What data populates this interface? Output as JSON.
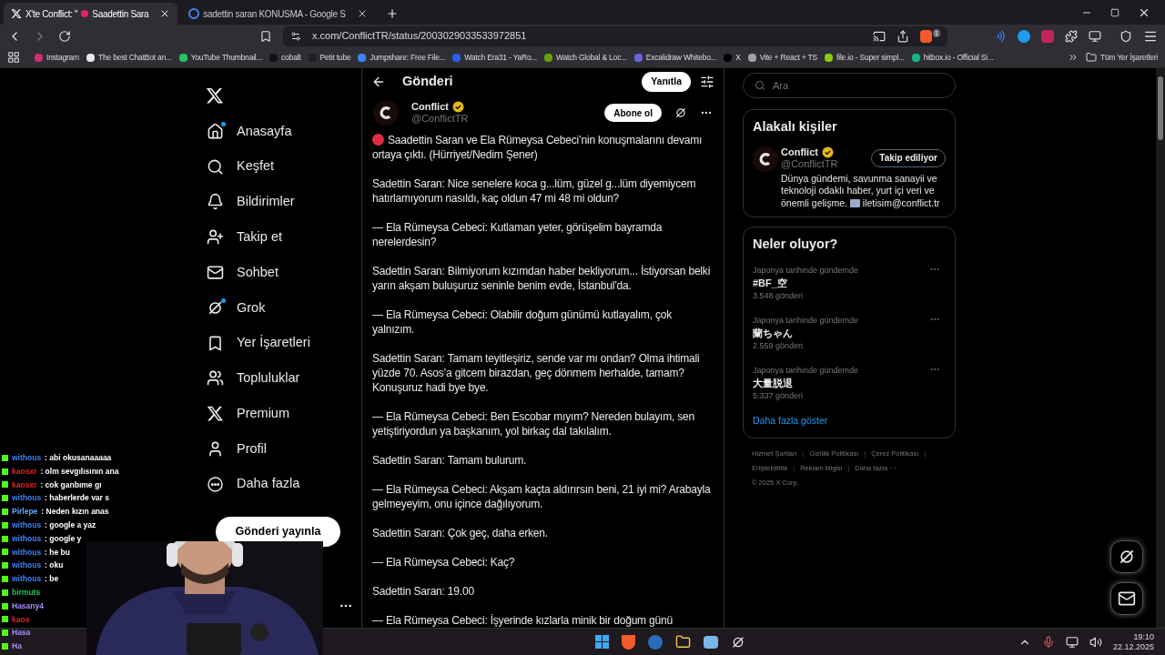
{
  "browser": {
    "tabs": [
      {
        "title": "X'te Conflict: \"",
        "title_rest": "Saadettin Sara",
        "selected": true,
        "kind": "x"
      },
      {
        "title": "sadettin saran KONUSMA - Google S",
        "selected": false,
        "kind": "google"
      }
    ],
    "url": "x.com/ConflictTR/status/2003029033533972851",
    "shield_count": "1",
    "bookmarks": [
      {
        "label": "Instagram",
        "color": "#d62976"
      },
      {
        "label": "The best ChatBot an...",
        "color": "#e5e7eb"
      },
      {
        "label": "YouTube Thumbnail...",
        "color": "#22c55e"
      },
      {
        "label": "cobalt",
        "color": "#111111"
      },
      {
        "label": "Petit tube",
        "color": "#1f1f1f"
      },
      {
        "label": "Jumpshare: Free File...",
        "color": "#3b82f6"
      },
      {
        "label": "Watch Era31 - YaRo...",
        "color": "#2563eb"
      },
      {
        "label": "Watch Global & Loc...",
        "color": "#65a30d"
      },
      {
        "label": "Excalidraw Whitebo...",
        "color": "#6965db"
      },
      {
        "label": "X",
        "color": "#000000"
      },
      {
        "label": "Vite + React + TS",
        "color": "#9ca3af"
      },
      {
        "label": "file.io - Super simpl...",
        "color": "#84cc16"
      },
      {
        "label": "hitbox.io - Official Si...",
        "color": "#10b981"
      }
    ],
    "all_bookmarks": "Tüm Yer İşaretleri"
  },
  "nav": {
    "items": [
      {
        "label": "Anasayfa",
        "kind": "home",
        "dot": true
      },
      {
        "label": "Keşfet",
        "kind": "search",
        "dot": false
      },
      {
        "label": "Bildirimler",
        "kind": "bell",
        "dot": false
      },
      {
        "label": "Takip et",
        "kind": "follow",
        "dot": false
      },
      {
        "label": "Sohbet",
        "kind": "mail",
        "dot": false
      },
      {
        "label": "Grok",
        "kind": "grok",
        "dot": true
      },
      {
        "label": "Yer İşaretleri",
        "kind": "bookmark",
        "dot": false
      },
      {
        "label": "Topluluklar",
        "kind": "people",
        "dot": false
      },
      {
        "label": "Premium",
        "kind": "x",
        "dot": false
      },
      {
        "label": "Profil",
        "kind": "user",
        "dot": false
      },
      {
        "label": "Daha fazla",
        "kind": "more",
        "dot": false
      }
    ],
    "post_button": "Gönderi yayınla"
  },
  "post": {
    "header": "Gönderi",
    "reply_button": "Yanıtla",
    "author": {
      "name": "Conflict",
      "handle": "@ConflictTR",
      "verified": true
    },
    "follow_button": "Abone ol",
    "paragraphs": [
      "Saadettin Saran ve Ela Rümeysa Cebeci’nin konuşmalarını devamı ortaya çıktı. (Hürriyet/Nedim Şener)",
      "Sadettin Saran: Nice senelere koca g...lüm, güzel g...lüm diyemiycem hatırlamıyorum nasıldı, kaç oldun 47 mi 48 mi oldun?",
      "— Ela Rümeysa Cebeci: Kutlaman yeter, görüşelim bayramda nerelerdesin?",
      "Sadettin Saran: Bilmiyorum kızımdan haber bekliyorum... İstiyorsan belki yarın akşam buluşuruz seninle benim evde, İstanbul’da.",
      "— Ela Rümeysa Cebeci: Olabilir doğum günümü kutlayalım, çok yalnızım.",
      "Sadettin Saran: Tamam teyitleşiriz, sende var mı ondan? Olma ihtimali yüzde 70. Asos’a gitcem birazdan, geç dönmem herhalde, tamam? Konuşuruz hadi bye bye.",
      "— Ela Rümeysa Cebeci: Ben Escobar mıyım? Nereden bulayım, sen yetiştiriyordun ya başkanım, yol birkaç dal takılalım.",
      "Sadettin Saran: Tamam bulurum.",
      "— Ela Rümeysa Cebeci: Akşam kaçta aldırırsın beni, 21 iyi mi? Arabayla gelmeyeyim, onu içince dağılıyorum.",
      "Sadettin Saran: Çok geç, daha erken.",
      "— Ela Rümeysa Cebeci: Kaç?",
      "Sadettin Saran: 19.00",
      "— Ela Rümeysa Cebeci: İşyerinde kızlarla minik bir doğum günü"
    ]
  },
  "sidebar": {
    "search_placeholder": "Ara",
    "related": {
      "title": "Alakalı kişiler",
      "name": "Conflict",
      "handle": "@ConflictTR",
      "verified": true,
      "button": "Takip ediliyor",
      "bio": "Dünya gündemi, savunma sanayii ve teknoloji odaklı haber, yurt içi veri ve önemli gelişme.",
      "bio_link": "iletisim@conflict.tr"
    },
    "trends": {
      "title": "Neler oluyor?",
      "items": [
        {
          "context": "Japonya tarihinde gündemde",
          "name": "#BF_空",
          "count": "3.548 gönderi"
        },
        {
          "context": "Japonya tarihinde gündemde",
          "name": "蘭ちゃん",
          "count": "2.559 gönderi"
        },
        {
          "context": "Japonya tarihinde gündemde",
          "name": "大量脱退",
          "count": "5.337 gönderi"
        }
      ],
      "more": "Daha fazla göster"
    },
    "footer": [
      "Hizmet Şartları",
      "|",
      "Gizlilik Politikası",
      "|",
      "Çerez Politikası",
      "|",
      "Erişilebilirlik",
      "|",
      "Reklam bilgisi",
      "|",
      "Daha fazla ···"
    ],
    "copyright": "© 2025 X Corp."
  },
  "chat": [
    {
      "user": "withous",
      "text": ": abi okusanaaaaa",
      "color": "#3b82f6"
    },
    {
      "user": "kaosxr",
      "text": ": olm sevgılısının ana",
      "color": "#dc2626"
    },
    {
      "user": "kaosxr",
      "text": ": cok ganbıme gı",
      "color": "#dc2626"
    },
    {
      "user": "withous",
      "text": ": haberlerde var s",
      "color": "#3b82f6"
    },
    {
      "user": "Pirlepe",
      "text": ": Neden kızın anas",
      "color": "#60a5fa"
    },
    {
      "user": "withous",
      "text": ": google a yaz",
      "color": "#3b82f6"
    },
    {
      "user": "withous",
      "text": ": google y",
      "color": "#3b82f6"
    },
    {
      "user": "withous",
      "text": ": he bu",
      "color": "#3b82f6"
    },
    {
      "user": "withous",
      "text": ": oku",
      "color": "#3b82f6"
    },
    {
      "user": "withous",
      "text": ": be",
      "color": "#3b82f6"
    },
    {
      "user": "birmuts",
      "color": "#22c55e"
    },
    {
      "user": "Hasany4",
      "color": "#a78bfa"
    },
    {
      "user": "kaos",
      "color": "#dc2626"
    },
    {
      "user": "Hasa",
      "color": "#a78bfa"
    },
    {
      "user": "Ha",
      "color": "#a78bfa"
    }
  ],
  "taskbar": {
    "time": "19:10",
    "date": "22.12.2025"
  }
}
